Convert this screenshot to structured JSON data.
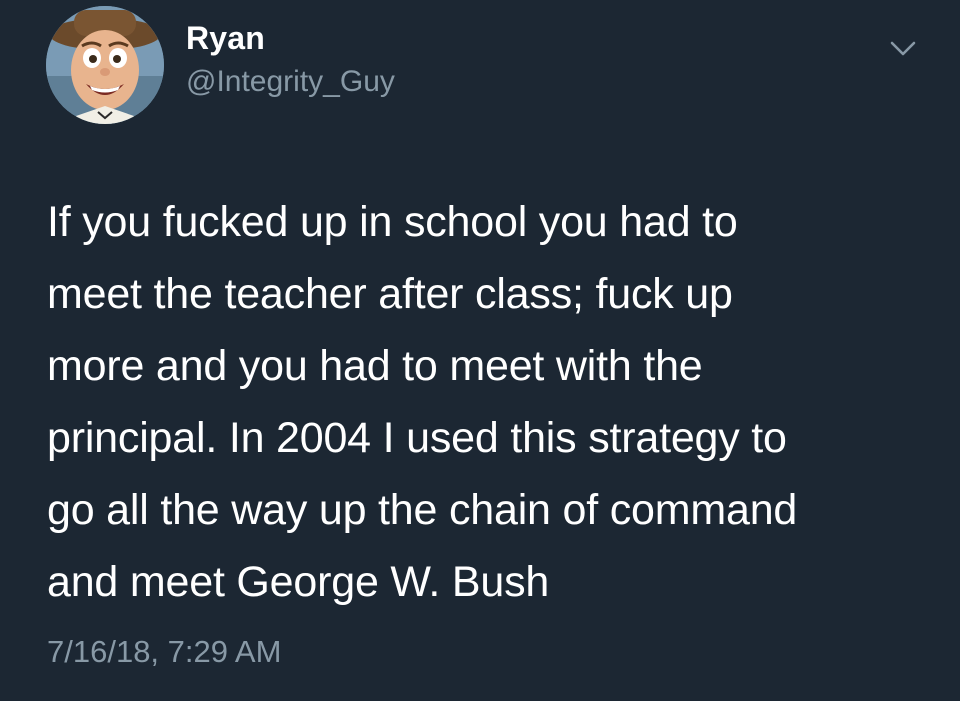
{
  "author": {
    "display_name": "Ryan",
    "handle": "@Integrity_Guy",
    "avatar_icon": "woody-cartoon-avatar"
  },
  "menu_icon": "chevron-down-icon",
  "tweet": {
    "text": "If you fucked up in school you had to\nmeet the teacher after class; fuck up\nmore and you had to meet with the\nprincipal. In 2004 I used this strategy to\ngo all the way up the chain of command\nand meet George W. Bush",
    "timestamp": "7/16/18, 7:29 AM"
  },
  "colors": {
    "background": "#1c2733",
    "primary_text": "#ffffff",
    "secondary_text": "#8899a6"
  }
}
